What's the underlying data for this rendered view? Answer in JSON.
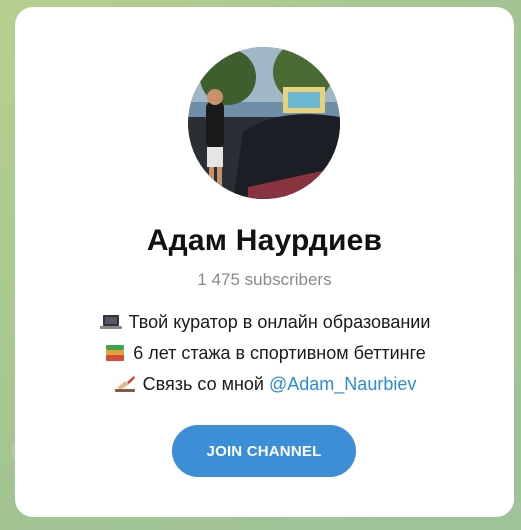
{
  "channel": {
    "name": "Адам Наурдиев",
    "subscribers": "1 475 subscribers",
    "description": [
      {
        "icon": "laptop-icon",
        "text": "Твой куратор в онлайн образовании",
        "link": ""
      },
      {
        "icon": "books-icon",
        "text": "6 лет стажа в спортивном беттинге",
        "link": ""
      },
      {
        "icon": "writing-hand-icon",
        "text": "Связь со мной ",
        "link": "@Adam_Naurbiev"
      }
    ],
    "join_label": "JOIN CHANNEL"
  },
  "colors": {
    "accent": "#3c8fd6",
    "link": "#2a8bd6",
    "background": "#a9c98e"
  }
}
